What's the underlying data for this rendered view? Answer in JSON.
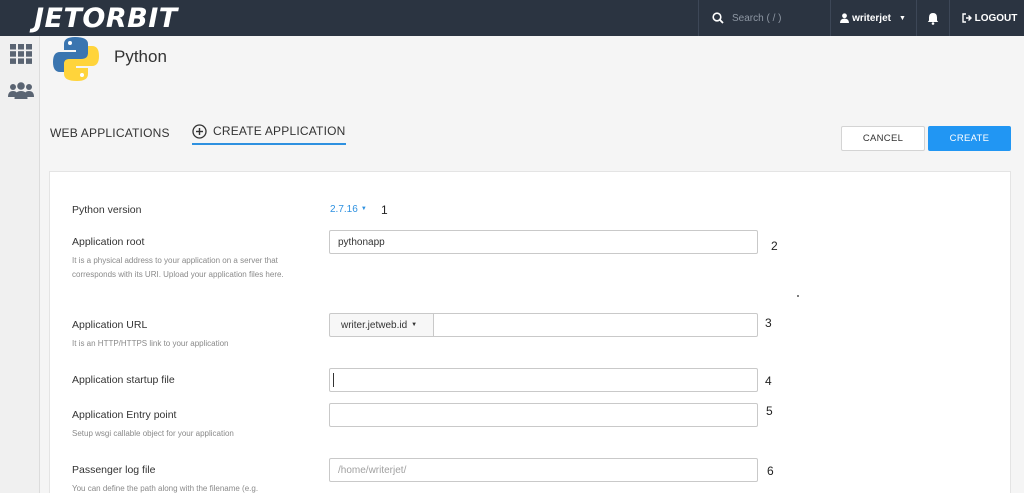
{
  "topbar": {
    "logo": "JETORBIT",
    "search_placeholder": "Search ( / )",
    "username": "writerjet",
    "logout_label": "LOGOUT",
    "icons": {
      "search": "search-icon",
      "user": "user-icon",
      "caret": "caret-down-icon",
      "bell": "bell-icon",
      "logout": "logout-icon"
    },
    "colors": {
      "background": "#2b3441"
    }
  },
  "sidebar": {
    "items": [
      {
        "icon": "apps-grid-icon"
      },
      {
        "icon": "users-icon"
      }
    ]
  },
  "header": {
    "title": "Python",
    "icon": "python-logo-icon"
  },
  "tabs": [
    {
      "label": "WEB APPLICATIONS",
      "active": false
    },
    {
      "label": "CREATE APPLICATION",
      "active": true,
      "icon": "plus-circle-icon"
    }
  ],
  "actions": {
    "cancel_label": "CANCEL",
    "create_label": "CREATE"
  },
  "form": {
    "python_version": {
      "label": "Python version",
      "value": "2.7.16",
      "marker": "1"
    },
    "app_root": {
      "label": "Application root",
      "hint": "It is a physical address to your application on a server that corresponds with its URI. Upload your application files here.",
      "value": "pythonapp",
      "marker": "2"
    },
    "app_url": {
      "label": "Application URL",
      "hint": "It is an HTTP/HTTPS link to your application",
      "domain": "writer.jetweb.id",
      "path_value": "",
      "marker": "3"
    },
    "startup_file": {
      "label": "Application startup file",
      "value": "",
      "marker": "4"
    },
    "entry_point": {
      "label": "Application Entry point",
      "hint": "Setup wsgi callable object for your application",
      "value": "",
      "marker": "5"
    },
    "passenger_log": {
      "label": "Passenger log file",
      "hint": "You can define the path along with the filename (e.g.",
      "placeholder": "/home/writerjet/",
      "marker": "6"
    }
  },
  "colors": {
    "accent": "#2196f3",
    "link": "#2e91e0"
  }
}
